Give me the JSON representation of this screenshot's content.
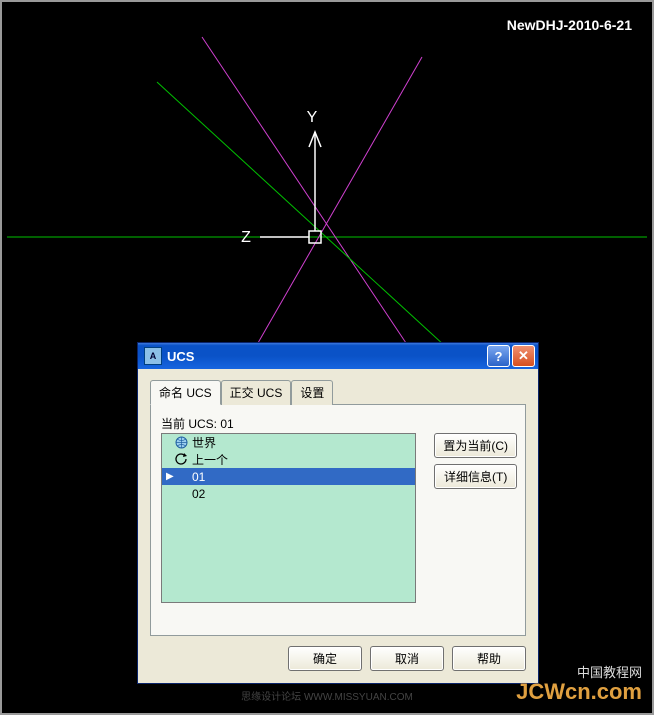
{
  "watermark": {
    "top": "NewDHJ-2010-6-21",
    "bottom_cn": "中国教程网",
    "bottom_url": "JCWcn.com",
    "center": "思缘设计论坛 WWW.MISSYUAN.COM"
  },
  "axes": {
    "y_label": "Y",
    "z_label": "Z"
  },
  "dialog": {
    "title": "UCS",
    "tabs": [
      {
        "label": "命名 UCS"
      },
      {
        "label": "正交 UCS"
      },
      {
        "label": "设置"
      }
    ],
    "current_label": "当前 UCS:  01",
    "list": {
      "items": [
        {
          "label": "世界",
          "icon": "globe"
        },
        {
          "label": "上一个",
          "icon": "prev"
        },
        {
          "label": "01",
          "icon": "",
          "selected": true,
          "marker": "▶"
        },
        {
          "label": "02",
          "icon": ""
        }
      ]
    },
    "side_buttons": {
      "set_current": "置为当前(C)",
      "details": "详细信息(T)"
    },
    "bottom_buttons": {
      "ok": "确定",
      "cancel": "取消",
      "help": "帮助"
    }
  }
}
